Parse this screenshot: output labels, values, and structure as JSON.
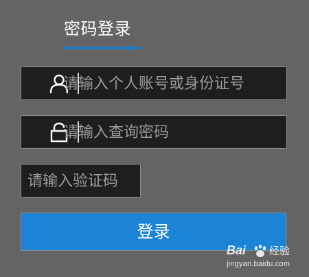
{
  "login_tab": {
    "title": "密码登录",
    "accent_color": "#1e7ccc"
  },
  "account_field": {
    "icon": "user-icon",
    "placeholder": "请输入个人账号或身份证号",
    "value": ""
  },
  "password_field": {
    "icon": "unlock-icon",
    "placeholder": "请输入查询密码",
    "value": ""
  },
  "captcha_field": {
    "placeholder": "请输入验证码",
    "value": ""
  },
  "login_button": {
    "label": "登录",
    "color": "#1b84d6"
  },
  "watermark": {
    "brand": "Bai",
    "name": "经验",
    "domain": "jingyan.baidu.com"
  }
}
